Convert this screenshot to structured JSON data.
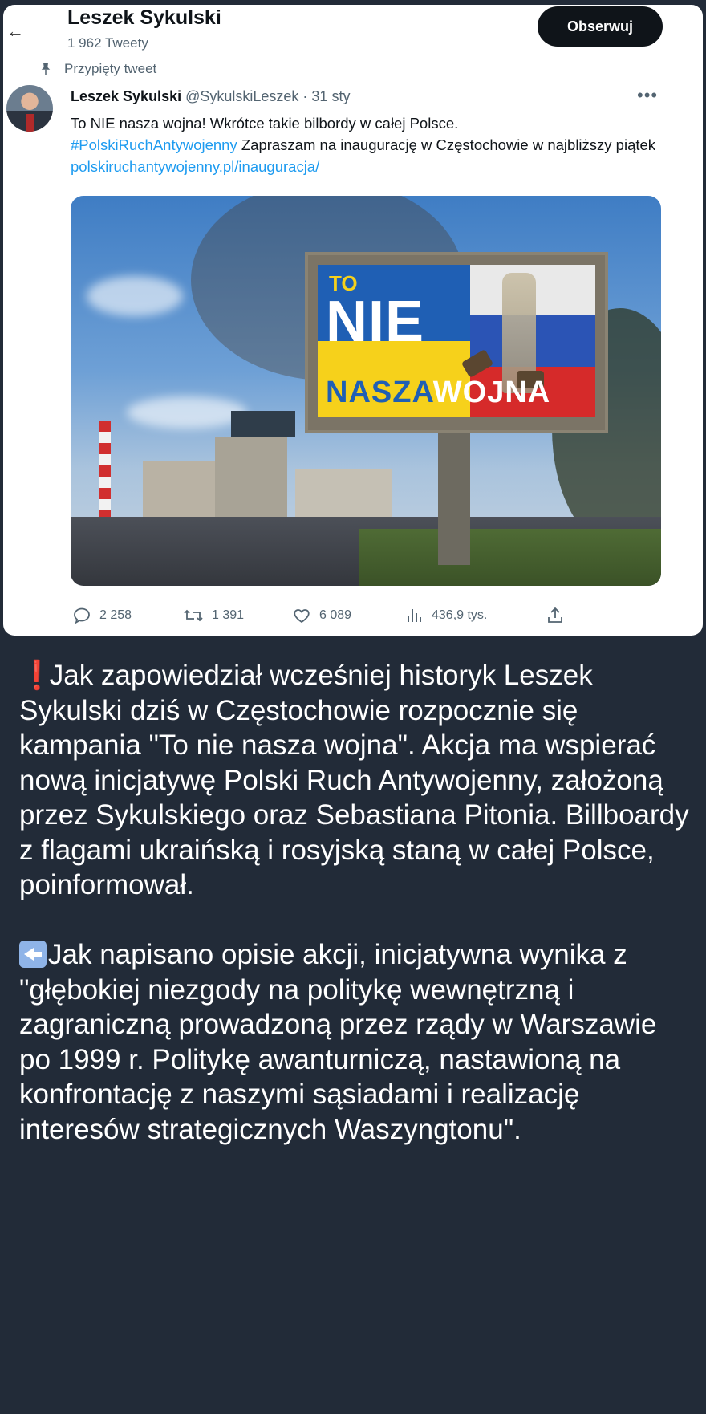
{
  "profile": {
    "name": "Leszek Sykulski",
    "tweet_count": "1 962 Tweety",
    "follow_label": "Obserwuj"
  },
  "tweet": {
    "pinned_label": "Przypięty tweet",
    "author_name": "Leszek Sykulski",
    "author_meta": "@SykulskiLeszek · 31 sty",
    "more_label": "•••",
    "text_line1": "To NIE nasza wojna! Wkrótce takie bilbordy w całej Polsce.",
    "hashtag": "#PolskiRuchAntywojenny",
    "text_line2_rest": " Zapraszam na inaugurację w Częstochowie w najbliższy piątek ",
    "link": "polskiruchantywojenny.pl/inauguracja/",
    "billboard": {
      "to": "TO",
      "nie": "NIE",
      "nasza": "NASZA",
      "wojna": "WOJNA"
    },
    "actions": {
      "replies": "2 258",
      "retweets": "1 391",
      "likes": "6 089",
      "views": "436,9 tys."
    }
  },
  "caption": {
    "paragraph1_emoji": "❗",
    "paragraph1": "Jak zapowiedział wcześniej historyk Leszek Sykulski dziś w Częstochowie rozpocznie się kampania \"To nie nasza wojna\". Akcja ma wspierać nową inicjatywę Polski Ruch Antywojenny, założoną przez Sykulskiego oraz Sebastiana Pitonia. Billboardy z flagami ukraińską i rosyjską staną w całej Polsce, poinformował.",
    "paragraph2": "Jak napisano opisie akcji, inicjatywna wynika z \"głębokiej niezgody na politykę wewnętrzną i zagraniczną prowadzoną przez rządy w Warszawie po 1999 r. Politykę awanturniczą, nastawioną na konfrontację z naszymi sąsiadami i realizację interesów strategicznych Waszyngtonu\"."
  },
  "icons": {
    "pin": "pin-icon",
    "reply": "reply-icon",
    "retweet": "retweet-icon",
    "like": "heart-icon",
    "views": "views-icon",
    "share": "share-icon",
    "back": "back-arrow-icon",
    "left_arrow_emoji": "left-arrow-icon"
  },
  "colors": {
    "link": "#1d9bf0",
    "background": "#222b38",
    "follow_button": "#0f1419"
  }
}
